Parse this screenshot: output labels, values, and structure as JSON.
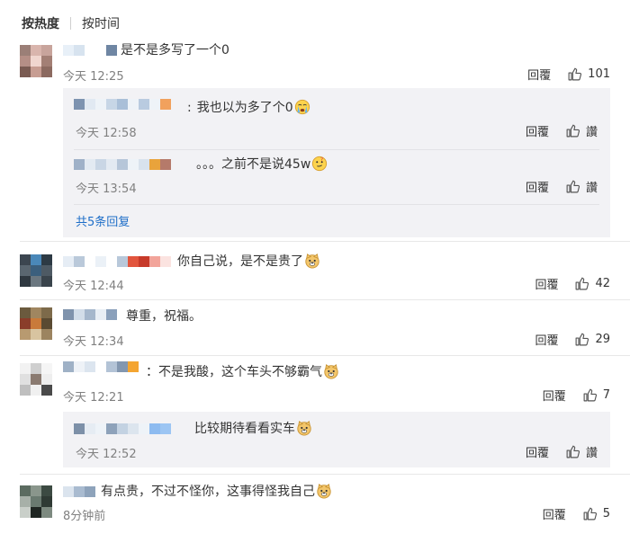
{
  "sort": {
    "hot": "按热度",
    "time": "按时间"
  },
  "actions": {
    "reply": "回覆",
    "like": "讚"
  },
  "comments": [
    {
      "text": "是不是多写了一个0",
      "time": "今天 12:25",
      "likes": "101"
    },
    {
      "text": "我也以为多了个0",
      "time": "今天 12:58",
      "likes": ""
    },
    {
      "text": "。。。之前不是说45w",
      "time": "今天 13:54",
      "likes": ""
    },
    {
      "more": "共5条回复"
    },
    {
      "text": "你自己说，是不是贵了",
      "time": "今天 12:44",
      "likes": "42"
    },
    {
      "text": "尊重，祝福。",
      "time": "今天 12:34",
      "likes": "29"
    },
    {
      "text": "：不是我酸，这个车头不够霸气",
      "time": "今天 12:21",
      "likes": "7"
    },
    {
      "text": "比较期待看看实车",
      "time": "今天 12:52",
      "likes": ""
    },
    {
      "text": "有点贵，不过不怪你，这事得怪我自己",
      "time": "8分钟前",
      "likes": "5"
    }
  ],
  "icons": {
    "like": "thumbs-up-icon",
    "crying": "crying-emoji-icon",
    "doge": "doge-emoji-icon",
    "thinking": "thinking-emoji-icon"
  }
}
